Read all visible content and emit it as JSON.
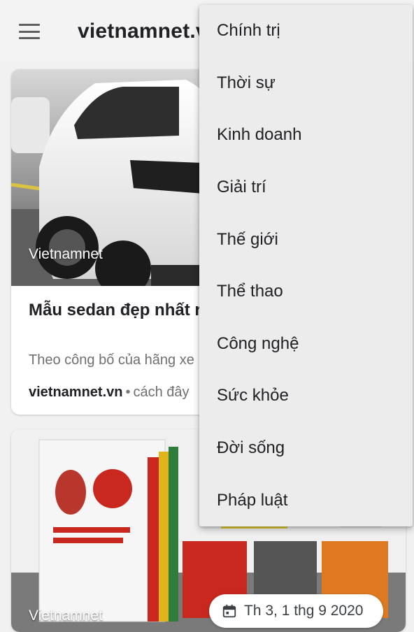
{
  "appbar": {
    "title": "vietnamnet.vn"
  },
  "card1": {
    "image_source": "Vietnamnet",
    "title": "Mẫu sedan đẹp nhất ra mắt có gì đặc biệt?",
    "snippet": "Theo công bố của hãng xe",
    "source": "vietnamnet.vn",
    "separator": "•",
    "time": "cách đây"
  },
  "card2": {
    "image_source": "Vietnamnet"
  },
  "date_chip": {
    "icon": "calendar-icon",
    "text": "Th 3, 1 thg 9 2020"
  },
  "menu": {
    "items": [
      {
        "label": "Chính trị"
      },
      {
        "label": "Thời sự"
      },
      {
        "label": "Kinh doanh"
      },
      {
        "label": "Giải trí"
      },
      {
        "label": "Thế giới"
      },
      {
        "label": "Thể thao"
      },
      {
        "label": "Công nghệ"
      },
      {
        "label": "Sức khỏe"
      },
      {
        "label": "Đời sống"
      },
      {
        "label": "Pháp luật"
      }
    ]
  }
}
